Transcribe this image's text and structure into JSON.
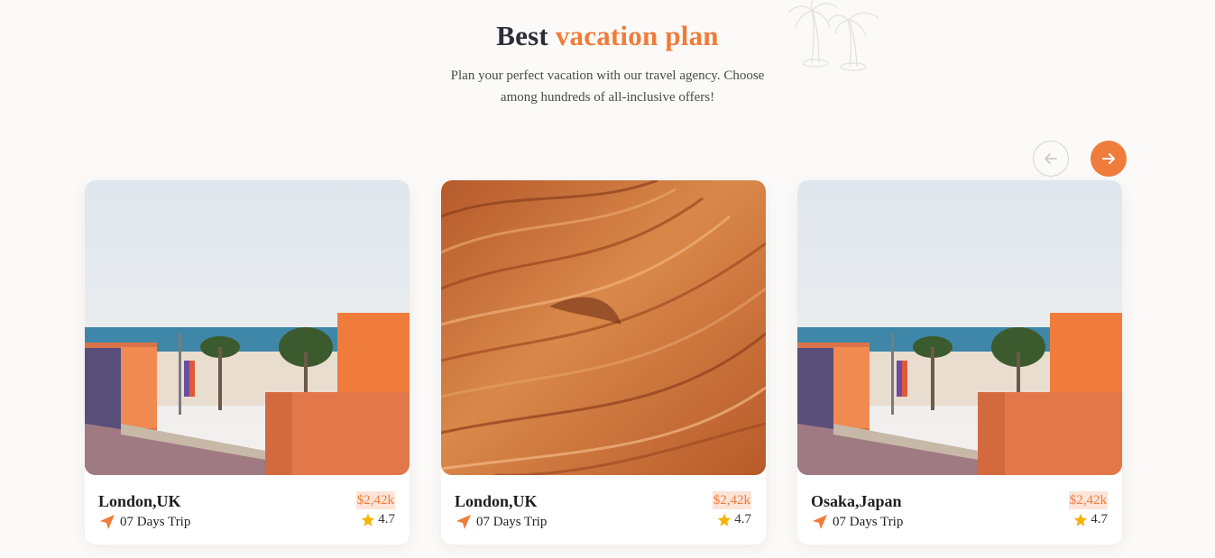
{
  "header": {
    "title_plain": "Best",
    "title_accent": "vacation plan",
    "subtitle": "Plan your perfect vacation with our travel agency. Choose among hundreds of all-inclusive offers!"
  },
  "carousel": {
    "prev_icon": "arrow-left-icon",
    "next_icon": "arrow-right-icon"
  },
  "cards": [
    {
      "name": "London,UK",
      "trip": "07 Days Trip",
      "price": "$2,42k",
      "rating": "4.7",
      "image": "beach-promenade-photo"
    },
    {
      "name": "London,UK",
      "trip": "07 Days Trip",
      "price": "$2,42k",
      "rating": "4.7",
      "image": "sandstone-canyon-photo"
    },
    {
      "name": "Osaka,Japan",
      "trip": "07 Days Trip",
      "price": "$2,42k",
      "rating": "4.7",
      "image": "beach-promenade-photo"
    }
  ],
  "colors": {
    "accent": "#f07c3b",
    "price_bg": "#fde4d8",
    "star": "#f5b400",
    "background": "#fcfaf8"
  }
}
